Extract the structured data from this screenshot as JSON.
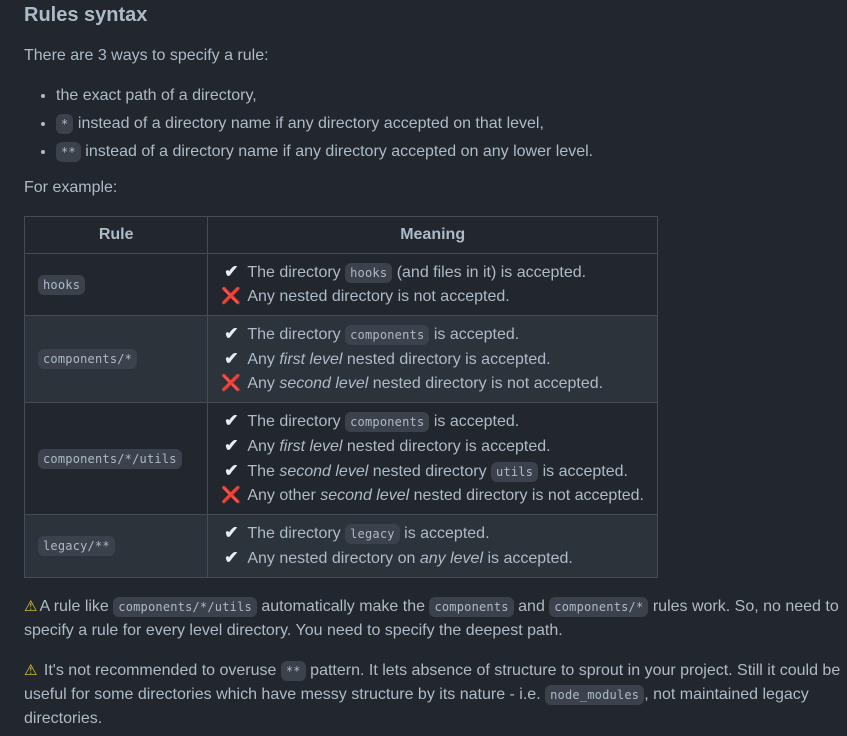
{
  "heading": "Rules syntax",
  "intro": "There are 3 ways to specify a rule:",
  "ways": [
    {
      "code": "",
      "text": "the exact path of a directory,"
    },
    {
      "code": "*",
      "text": " instead of a directory name if any directory accepted on that level,"
    },
    {
      "code": "**",
      "text": " instead of a directory name if any directory accepted on any lower level."
    }
  ],
  "example_label": "For example:",
  "table": {
    "headers": [
      "Rule",
      "Meaning"
    ],
    "rows": [
      {
        "rule": "hooks",
        "lines": [
          {
            "mark": "✔",
            "parts": [
              "The directory ",
              {
                "code": "hooks"
              },
              " (and files in it) is accepted."
            ]
          },
          {
            "mark": "❌",
            "parts": [
              "Any nested directory is not accepted."
            ]
          }
        ]
      },
      {
        "rule": "components/*",
        "lines": [
          {
            "mark": "✔",
            "parts": [
              "The directory ",
              {
                "code": "components"
              },
              " is accepted."
            ]
          },
          {
            "mark": "✔",
            "parts": [
              "Any ",
              {
                "em": "first level"
              },
              " nested directory is accepted."
            ]
          },
          {
            "mark": "❌",
            "parts": [
              "Any ",
              {
                "em": "second level"
              },
              " nested directory is not accepted."
            ]
          }
        ]
      },
      {
        "rule": "components/*/utils",
        "lines": [
          {
            "mark": "✔",
            "parts": [
              "The directory ",
              {
                "code": "components"
              },
              " is accepted."
            ]
          },
          {
            "mark": "✔",
            "parts": [
              "Any ",
              {
                "em": "first level"
              },
              " nested directory is accepted."
            ]
          },
          {
            "mark": "✔",
            "parts": [
              "The ",
              {
                "em": "second level"
              },
              " nested directory ",
              {
                "code": "utils"
              },
              " is accepted."
            ]
          },
          {
            "mark": "❌",
            "parts": [
              "Any other ",
              {
                "em": "second level"
              },
              " nested directory is not accepted."
            ]
          }
        ]
      },
      {
        "rule": "legacy/**",
        "lines": [
          {
            "mark": "✔",
            "parts": [
              "The directory ",
              {
                "code": "legacy"
              },
              " is accepted."
            ]
          },
          {
            "mark": "✔",
            "parts": [
              "Any nested directory on ",
              {
                "em": "any level"
              },
              " is accepted."
            ]
          }
        ]
      }
    ]
  },
  "notes": [
    {
      "icon": "⚠",
      "parts": [
        "A rule like ",
        {
          "code": "components/*/utils"
        },
        " automatically make the ",
        {
          "code": "components"
        },
        " and ",
        {
          "code": "components/*"
        },
        " rules work. So, no need to specify a rule for every level directory. You need to specify the deepest path."
      ]
    },
    {
      "icon": "⚠",
      "parts": [
        " It's not recommended to overuse ",
        {
          "code": "**"
        },
        " pattern. It lets absence of structure to sprout in your project. Still it could be useful for some directories which have messy structure by its nature - i.e. ",
        {
          "code": "node_modules"
        },
        ", not maintained legacy directories."
      ]
    }
  ],
  "colors": {
    "background": "#22272e",
    "stripe": "#2d333b",
    "border": "#444c56",
    "text": "#adbac7",
    "code_bg": "#3b424b",
    "cross": "#e5383b",
    "warning": "#f2c335"
  }
}
